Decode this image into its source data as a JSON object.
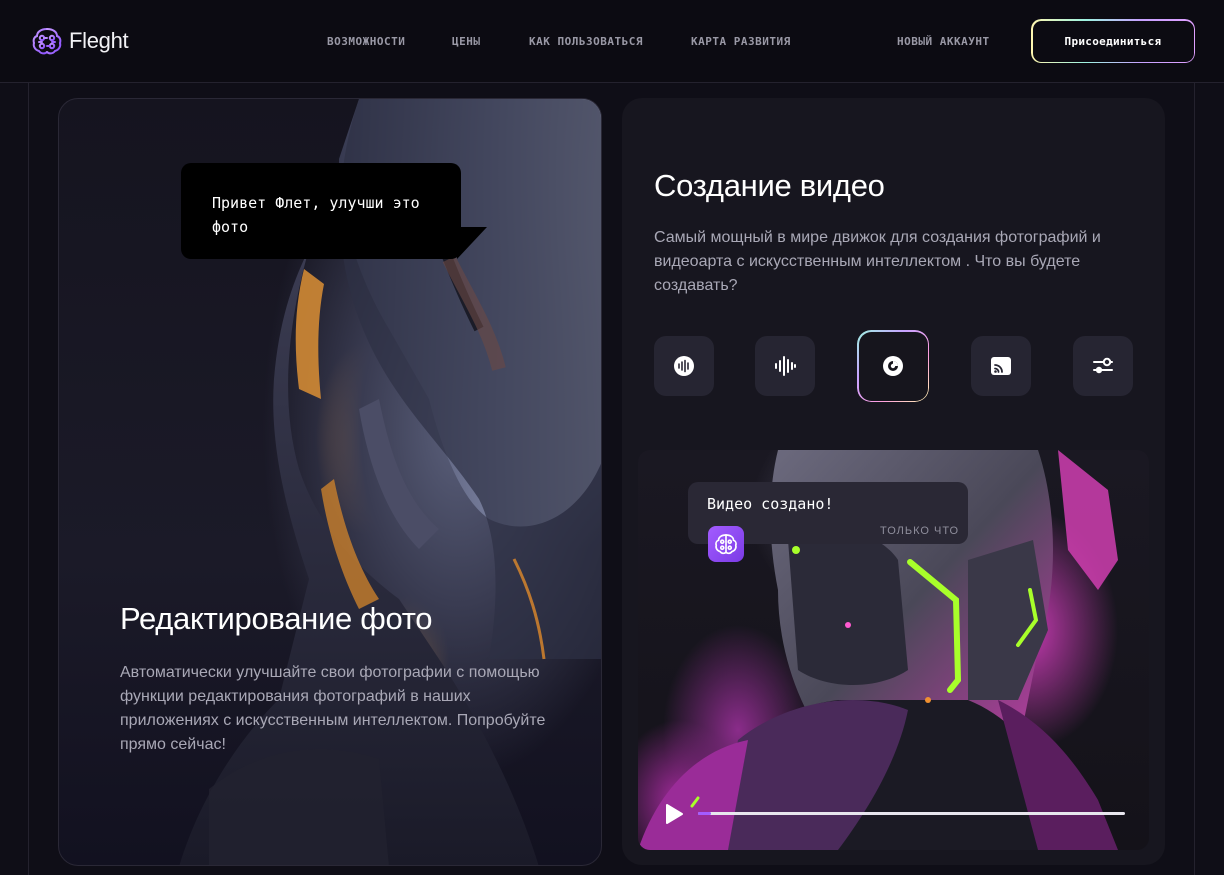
{
  "header": {
    "logo_text": "Fleght",
    "nav": [
      {
        "label": "Возможности"
      },
      {
        "label": "Цены"
      },
      {
        "label": "Как пользоваться"
      },
      {
        "label": "Карта развития"
      }
    ],
    "new_account": "Новый аккаунт",
    "join_button": "Присоединиться"
  },
  "photo_card": {
    "bubble_text": "Привет Флет, улучши это фото",
    "title": "Редактирование фото",
    "description": "Автоматически улучшайте свои фотографии с помощью функции редактирования фотографий в наших приложениях с искусственным интеллектом. Попробуйте прямо сейчас!"
  },
  "video_card": {
    "title": "Создание видео",
    "description": "Самый мощный в мире движок для создания фотографий и видеоарта с искусственным интеллектом . Что вы будете создавать?",
    "tools": [
      {
        "icon": "voice-wave-icon"
      },
      {
        "icon": "audio-bars-icon"
      },
      {
        "icon": "video-disc-icon",
        "active": true
      },
      {
        "icon": "cast-icon"
      },
      {
        "icon": "sliders-icon"
      }
    ],
    "bubble_text": "Видео создано!",
    "bubble_time": "только что",
    "progress": 0.03
  },
  "colors": {
    "background": "#0f0e17",
    "card": "#17161f",
    "accent": "#a35cff"
  }
}
